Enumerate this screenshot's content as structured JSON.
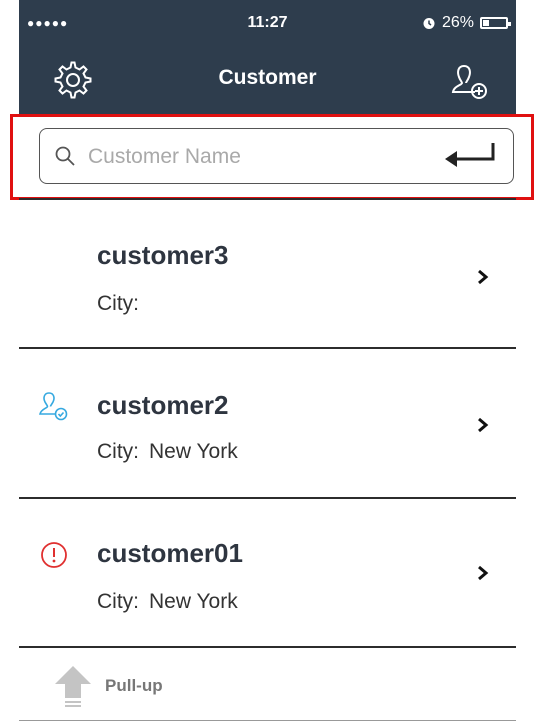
{
  "status": {
    "signal": "●●●●●",
    "time": "11:27",
    "battery_text": "26%",
    "battery_level": 26,
    "alarm_icon": "alarm-icon"
  },
  "nav": {
    "title": "Customer",
    "left_icon": "gear-icon",
    "right_icon": "add-user-icon"
  },
  "search": {
    "placeholder": "Customer Name",
    "value": "",
    "icon": "search-icon",
    "submit_icon": "enter-icon"
  },
  "customers": [
    {
      "name": "customer3",
      "city_label": "City:",
      "city": "",
      "status_icon": ""
    },
    {
      "name": "customer2",
      "city_label": "City:",
      "city": "New York",
      "status_icon": "user-check-icon"
    },
    {
      "name": "customer01",
      "city_label": "City:",
      "city": "New York",
      "status_icon": "alert-circle-icon"
    }
  ],
  "pull_up": {
    "label": "Pull-up",
    "icon": "arrow-up-icon"
  },
  "colors": {
    "nav_bg": "#2e3d4d",
    "highlight": "#e01010",
    "accent_blue": "#36a9e0",
    "alert_red": "#e03030"
  }
}
